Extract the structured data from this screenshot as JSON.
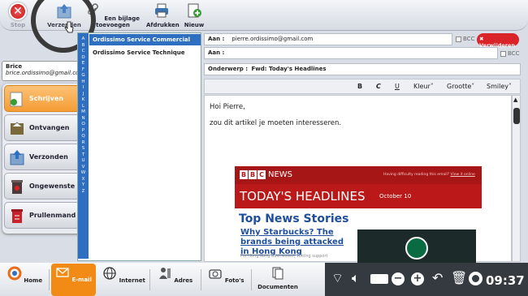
{
  "toolbar": {
    "stop": "Stop",
    "send": "Verzenden",
    "attach": "Een bijlage toevoegen",
    "print": "Afdrukken",
    "new": "Nieuw"
  },
  "user": {
    "name": "Brice",
    "email": "brice.ordissimo@gmail.com"
  },
  "folders": [
    "Schrijven",
    "Ontvangen",
    "Verzonden",
    "Ongewenste",
    "Prullenmand"
  ],
  "alphabet": "ABCDEFGHIJKLMNOPQRSTUVWXYZ",
  "contacts": [
    "Ordissimo Service Commercial",
    "Ordissimo Service Technique"
  ],
  "form": {
    "to_label": "Aan :",
    "to_value": "pierre.ordissimo@gmail.com",
    "cc_label": "Aan :",
    "subject_label": "Onderwerp :",
    "subject_value": "Fwd: Today's Headlines",
    "bcc": "BCC",
    "delete": "Verwijderen"
  },
  "format": {
    "bold": "B",
    "italic": "C",
    "underline": "U",
    "color": "Kleur",
    "size": "Grootte",
    "smiley": "Smiley"
  },
  "body": {
    "line1": "Hoi Pierre,",
    "line2": "zou dit artikel je moeten interesseren."
  },
  "newsletter": {
    "brand": "BBC",
    "news": "NEWS",
    "notice": "Having difficulty reading this email?",
    "view": "View it online",
    "headline": "TODAY'S HEADLINES",
    "date": "October 10",
    "top": "Top News Stories",
    "article": "Why Starbucks? The brands being attacked in Hong Kong",
    "sub": "For Hong Kong businesses, voicing support"
  },
  "taskbar": {
    "home": "Home",
    "email": "E-mail",
    "internet": "Internet",
    "contacts": "Adres",
    "photos": "Foto's",
    "docs": "Documenten"
  },
  "clock": "09:37",
  "colors": {
    "accent": "#f28b16",
    "blue": "#2f6fc1",
    "bbc": "#bb1919"
  }
}
